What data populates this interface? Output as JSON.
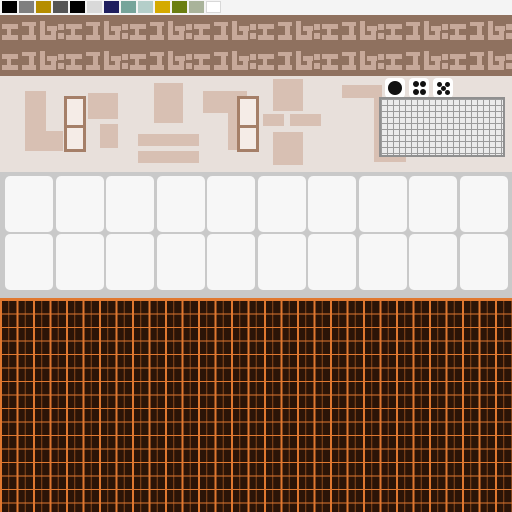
{
  "palette": {
    "swatches": [
      "#000000",
      "#7f7f7f",
      "#b58d00",
      "#555555",
      "#000000",
      "#d9d9d9",
      "#1f1f5e",
      "#76a49a",
      "#b4cec9",
      "#d4aa00",
      "#6b7f12",
      "#a9b39a",
      "#ffffff"
    ]
  },
  "tiles": {
    "tile_color": "#c7a99a",
    "background": "#8f715f"
  },
  "workspace": {
    "dice": [
      "one-pip-die",
      "four-pip-die",
      "five-pip-die"
    ],
    "grid_color": "#9b9b9b"
  },
  "slots": {
    "rows": 2,
    "columns": 10
  },
  "canvas": {
    "background": "#2b1407",
    "line_color": "#e07830"
  }
}
